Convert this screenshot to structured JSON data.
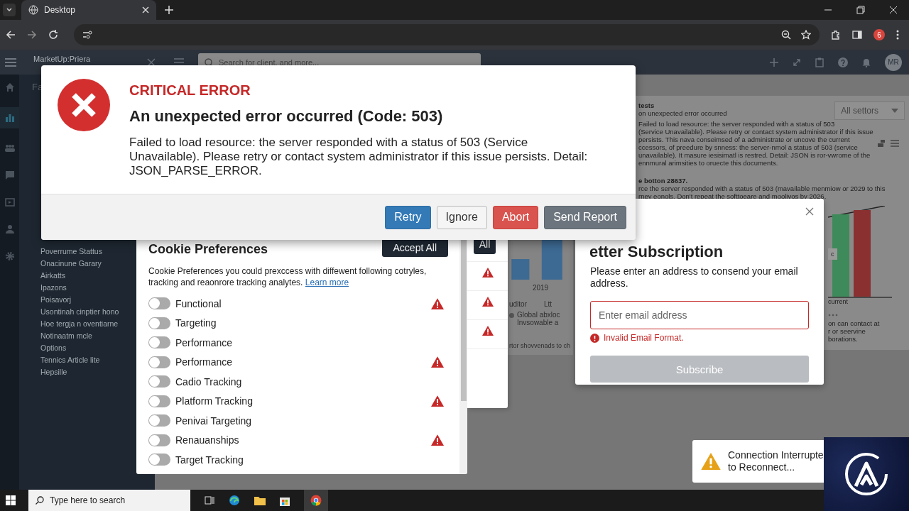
{
  "browser": {
    "tab": {
      "title": "Desktop"
    },
    "extension_badge": "6"
  },
  "app_header": {
    "title": "MarketUp:Priera",
    "search": {
      "placeholder": "Search for client, and more..."
    },
    "avatar": "MR"
  },
  "icon_rail": [
    {
      "selected": false
    },
    {
      "selected": true
    },
    {
      "selected": false
    },
    {
      "selected": false
    },
    {
      "selected": false
    },
    {
      "selected": false
    },
    {
      "selected": false
    }
  ],
  "sidebar": {
    "heading": "Fa",
    "items": [
      "Poverrume Stattus",
      "Onacinune Garary",
      "Airkatts",
      "Ipazons",
      "Poisavorj",
      "Usontinah cinptier hono",
      "Hoe tergja n oventiarne",
      "Notinaatm mcle",
      "Options",
      "Tennics Article lite",
      "Hepsille"
    ]
  },
  "background_panel": {
    "dropdown": "All settors",
    "lines": [
      "tests",
      "on unexpected error occurred",
      "Failed to load resource:  the server responded with a status of 503",
      "(Service Unavailable).  Please retry or contact system administrator if this issue",
      "persists.  This nava conseimsed of a administrate or uncove the current",
      "ccessors, of preedure by snness: the server-nmol a status of 503 (service",
      "unavailable). It masure iesisimatl is restred. Detail: JSON is ror-vwrome of the",
      "ennmural arimsities to oruecte this documents."
    ],
    "note_title": "e botton 28637.",
    "note_lines": [
      "rce the server responded with a status of 503 (mavailable menmiow or 2029 to this",
      "rney eonols. Don't repeat the softtoeare and moolivos by 2026."
    ],
    "chart_label": "current",
    "chart_tag": "c",
    "contact_lines": [
      "on can contact at",
      "r or seervine",
      "borations."
    ]
  },
  "middle_panel": {
    "year": "2019",
    "headers": [
      "uditor",
      "Ltt"
    ],
    "legend": [
      "Global abxloc",
      "Invsowable a"
    ],
    "footer": "rtor shovvenads to ch"
  },
  "error_dialog": {
    "severity": "CRITICAL ERROR",
    "title": "An unexpected error occurred (Code: 503)",
    "message": "Failed to load resource: the server responded with a status of 503 (Service Unavailable). Please retry or contact system administrator if this issue persists. Detail: JSON_PARSE_ERROR.",
    "buttons": [
      {
        "label": "Retry",
        "kind": "primary"
      },
      {
        "label": "Ignore",
        "kind": "default"
      },
      {
        "label": "Abort",
        "kind": "danger"
      },
      {
        "label": "Send Report",
        "kind": "secondary"
      }
    ]
  },
  "cookie_panel": {
    "title": "Cookie Preferences",
    "accept_button": "Accept All",
    "description": "Cookie Preferences you could prexccess with diffewent following cotryles, tracking and reaonrore tracking analytes.",
    "link": "Learn more",
    "items": [
      {
        "label": "Functional",
        "on": false,
        "warning": true
      },
      {
        "label": "Targeting",
        "on": false,
        "warning": false
      },
      {
        "label": "Performance",
        "on": false,
        "warning": false
      },
      {
        "label": "Performance",
        "on": false,
        "warning": true
      },
      {
        "label": "Cadio Tracking",
        "on": false,
        "warning": false
      },
      {
        "label": "Platform Tracking",
        "on": false,
        "warning": true
      },
      {
        "label": "Penivai Targeting",
        "on": false,
        "warning": false
      },
      {
        "label": "Renauanships",
        "on": false,
        "warning": true
      },
      {
        "label": "Target Tracking",
        "on": false,
        "warning": false
      }
    ]
  },
  "back_panel": {
    "button": "All",
    "rows": [
      {
        "warning": true
      },
      {
        "warning": true
      },
      {
        "warning": true
      },
      {
        "warning": false
      }
    ]
  },
  "newsletter": {
    "title": "etter Subscription",
    "description": "Please enter an address to consend your email address.",
    "email": {
      "placeholder": "Enter email address",
      "invalid": true
    },
    "error": "Invalid Email Format.",
    "button": {
      "label": "Subscribe",
      "disabled": true
    }
  },
  "toast": {
    "lines": [
      "Connection Interrupte",
      "to Reconnect..."
    ]
  },
  "taskbar": {
    "search": {
      "placeholder": "Type here to search"
    }
  }
}
